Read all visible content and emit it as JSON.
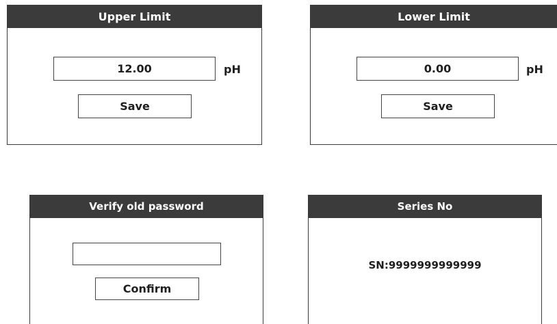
{
  "upper_limit": {
    "title": "Upper Limit",
    "value": "12.00",
    "unit": "pH",
    "save_label": "Save"
  },
  "lower_limit": {
    "title": "Lower Limit",
    "value": "0.00",
    "unit": "pH",
    "save_label": "Save"
  },
  "verify_password": {
    "title": "Verify old password",
    "value": "",
    "confirm_label": "Confirm"
  },
  "series_no": {
    "title": "Series No",
    "serial": "SN:9999999999999"
  },
  "colors": {
    "header_bg": "#3b3b3b",
    "header_text": "#ffffff",
    "border": "#444444"
  }
}
